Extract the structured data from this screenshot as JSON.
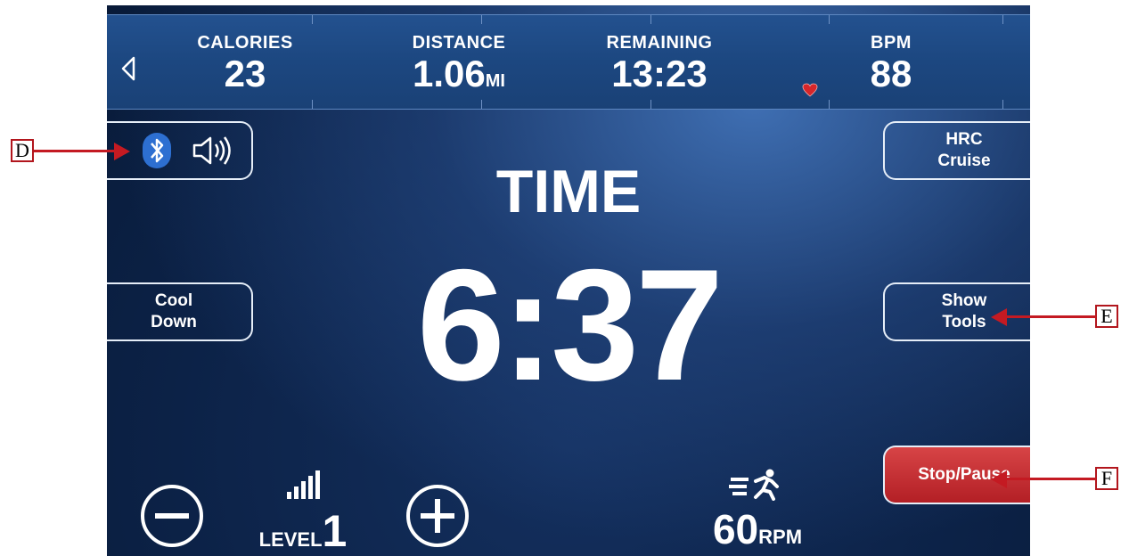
{
  "stats": {
    "calories": {
      "label": "CALORIES",
      "value": "23"
    },
    "distance": {
      "label": "DISTANCE",
      "value": "1.06",
      "unit": "MI"
    },
    "remaining": {
      "label": "REMAINING",
      "value": "13:23"
    },
    "bpm": {
      "label": "BPM",
      "value": "88"
    }
  },
  "main": {
    "label": "TIME",
    "value": "6:37"
  },
  "buttons": {
    "hrc_cruise": "HRC\nCruise",
    "cool_down": "Cool\nDown",
    "show_tools": "Show\nTools",
    "stop_pause": "Stop/Pause"
  },
  "level": {
    "word": "LEVEL",
    "value": "1"
  },
  "cadence": {
    "value": "60",
    "unit": "RPM"
  },
  "callouts": {
    "d": "D",
    "e": "E",
    "f": "F"
  },
  "icons": [
    "back-arrow-icon",
    "heart-icon",
    "bluetooth-icon",
    "speaker-icon",
    "minus-circle-icon",
    "plus-circle-icon",
    "signal-bars-icon",
    "runner-icon"
  ],
  "colors": {
    "accent_red": "#b31f25",
    "heart": "#d6262a",
    "callout": "#c41a22"
  }
}
